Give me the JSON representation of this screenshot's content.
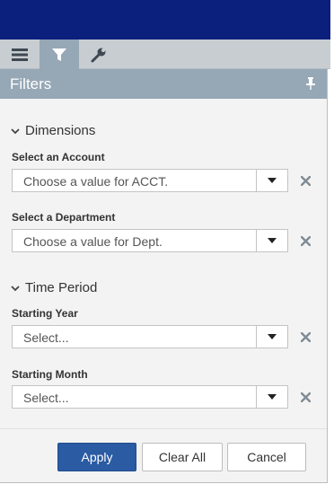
{
  "tabs": [
    {
      "icon": "menu-icon",
      "active": false
    },
    {
      "icon": "filter-icon",
      "active": true
    },
    {
      "icon": "wrench-icon",
      "active": false
    }
  ],
  "panel": {
    "title": "Filters",
    "sections": [
      {
        "label": "Dimensions",
        "fields": [
          {
            "label": "Select an Account",
            "placeholder": "Choose a value for ACCT."
          },
          {
            "label": "Select a Department",
            "placeholder": "Choose a value for Dept."
          }
        ]
      },
      {
        "label": "Time Period",
        "fields": [
          {
            "label": "Starting Year",
            "placeholder": "Select..."
          },
          {
            "label": "Starting Month",
            "placeholder": "Select..."
          }
        ]
      }
    ]
  },
  "buttons": {
    "apply": "Apply",
    "clear_all": "Clear All",
    "cancel": "Cancel"
  },
  "colors": {
    "top_bar": "#0b1f7c",
    "panel_header": "#96a7b5",
    "apply_button": "#2a5ba3"
  }
}
